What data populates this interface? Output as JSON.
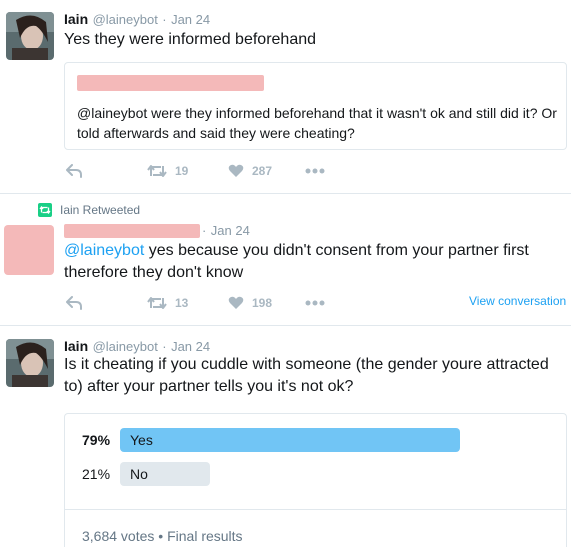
{
  "tweets": [
    {
      "author_name": "Iain",
      "handle": "@laineybot",
      "date": "Jan 24",
      "separator": "·",
      "text": "Yes they were informed beforehand",
      "quoted": {
        "text": "@laineybot were they informed beforehand that it wasn't ok and still did it? Or told afterwards and said they were cheating?"
      },
      "retweets": "19",
      "likes": "287"
    },
    {
      "retweet_label": "Iain Retweeted",
      "date": "Jan 24",
      "separator": "·",
      "mention": "@laineybot",
      "text": " yes because you didn't consent from your partner first therefore they don't know",
      "retweets": "13",
      "likes": "198",
      "view_conversation": "View conversation"
    },
    {
      "author_name": "Iain",
      "handle": "@laineybot",
      "date": "Jan 24",
      "separator": "·",
      "text": "Is it cheating if you cuddle with someone (the gender youre attracted to) after your partner tells you it's not ok?",
      "poll": {
        "options": [
          {
            "label": "Yes",
            "percent": "79%",
            "share": 0.79,
            "color": "#71c5f5",
            "winner": true
          },
          {
            "label": "No",
            "percent": "21%",
            "share": 0.21,
            "color": "#e1e8ed",
            "winner": false
          }
        ],
        "votes": "3,684 votes",
        "status": "Final results",
        "separator": "•"
      }
    }
  ],
  "colors": {
    "link": "#1da1f2",
    "icon": "#aab8c2",
    "retweet_green": "#19cf86",
    "redaction": "#f4b9b9"
  },
  "icons": [
    "reply-icon",
    "retweet-icon",
    "like-icon",
    "more-icon",
    "retweeted-icon"
  ]
}
